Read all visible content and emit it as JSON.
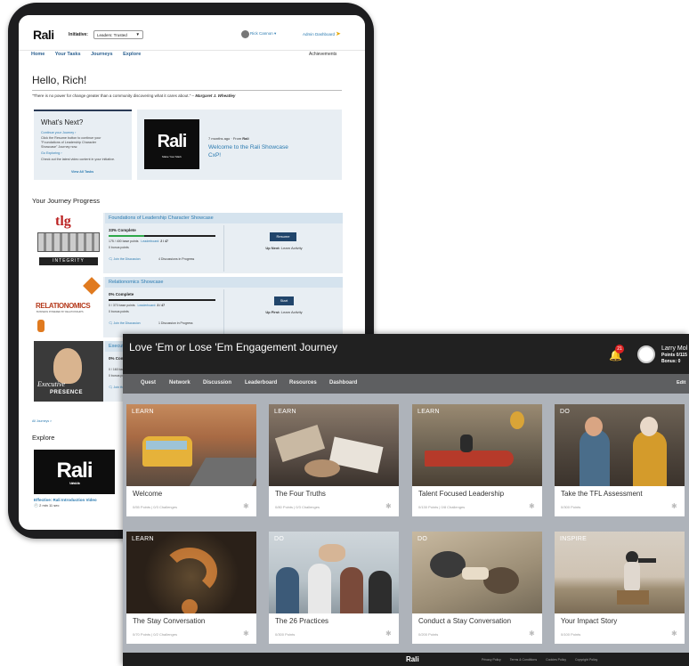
{
  "tablet": {
    "logo": "Rali",
    "initiative_label": "Initiative:",
    "initiative_value": "Leaders: Trusted",
    "user_name": "Rick Cannon",
    "admin_link": "Admin Dashboard",
    "nav": [
      "Home",
      "Your Tasks",
      "Journeys",
      "Explore"
    ],
    "achievements": "Achievements",
    "greeting": "Hello, Rich!",
    "quote_text": "\"There is no power for change greater than a community discovering what it cares about.\" –",
    "quote_author": "Margaret J. Wheatley",
    "whats_next": {
      "title": "What's Next?",
      "link1": "Continue your Journey",
      "text1": "Click the Resume button to continue your \"Foundations of Leadership Character Showcase\" Journey now.",
      "link2": "Go Exploring",
      "text2": "Check out the latest video content in your initiative.",
      "view_all": "View All Tasks"
    },
    "featured": {
      "video_logo": "Rali",
      "video_tagline": "Make Your Mark",
      "meta_time": "7 months ago",
      "meta_from": "From",
      "meta_source": "Rali",
      "title": "Welcome to the Rali Showcase CxP!"
    },
    "journey_progress_heading": "Your Journey Progress",
    "journeys": [
      {
        "title": "Foundations of Leadership Character Showcase",
        "percent_label": "33% Complete",
        "progress": 0.33,
        "points_line": "175 / 400 base points",
        "leaderboard_label": "Leaderboard:",
        "leaderboard_value": "2 / 47",
        "bonus": "0 bonus points",
        "discussion_link": "Join the Discussion",
        "discussion_count": "4 Discussions in Progress",
        "button": "Resume",
        "next_label": "Up Next:",
        "next_value": "Learn Activity",
        "img_text1": "tlg",
        "img_text2": "INTEGRITY"
      },
      {
        "title": "Relationomics Showcase",
        "percent_label": "0% Complete",
        "progress": 0,
        "points_line": "0 / 370 base points",
        "leaderboard_label": "Leaderboard:",
        "leaderboard_value": "3 / 47",
        "bonus": "0 bonus points",
        "discussion_link": "Join the Discussion",
        "discussion_count": "1 Discussion in Progress",
        "button": "Start",
        "next_label": "Up First:",
        "next_value": "Learn Activity",
        "img_text1": "RELATIONOMICS",
        "img_text2": "BUSINESS POWERED BY RELATIONSHIPS"
      },
      {
        "title": "Executi",
        "percent_label": "0% Com",
        "progress": 0,
        "points_line": "0 / 160 bas",
        "bonus": "0 bonus po",
        "discussion_link": "Join th",
        "img_text1": "Executive",
        "img_text2": "PRESENCE"
      }
    ],
    "all_journeys": "All Journeys >",
    "explore_heading": "Explore",
    "explore_video_logo": "Rali",
    "explore_video_tagline": "Make Your Mark",
    "explore_caption": "Effective: Rali Introduction Video",
    "explore_duration": "2 min 11 sec"
  },
  "window": {
    "title": "Love 'Em or Lose 'Em Engagement Journey",
    "notification_count": "21",
    "user_name": "Larry Mol",
    "points": "Points 0/115",
    "bonus": "Bonus: 0",
    "tabs": [
      "Quest",
      "Network",
      "Discussion",
      "Leaderboard",
      "Resources",
      "Dashboard"
    ],
    "edit": "Edit",
    "cards": [
      {
        "tag": "LEARN",
        "title": "Welcome",
        "meta": "0/55 Points | 0/3 Challenges"
      },
      {
        "tag": "LEARN",
        "title": "The Four Truths",
        "meta": "0/80 Points | 0/3 Challenges"
      },
      {
        "tag": "LEARN",
        "title": "Talent Focused Leadership",
        "meta": "0/130 Points | 0/8 Challenges"
      },
      {
        "tag": "DO",
        "title": "Take the TFL Assessment",
        "meta": "0/300 Points"
      },
      {
        "tag": "LEARN",
        "title": "The Stay Conversation",
        "meta": "0/70 Points | 0/2 Challenges"
      },
      {
        "tag": "DO",
        "title": "The 26 Practices",
        "meta": "0/300 Points"
      },
      {
        "tag": "DO",
        "title": "Conduct a Stay Conversation",
        "meta": "0/200 Points"
      },
      {
        "tag": "INSPIRE",
        "title": "Your Impact Story",
        "meta": "0/100 Points"
      }
    ],
    "footer_logo": "Rali",
    "footer_links": [
      "Privacy Policy",
      "Terms & Conditions",
      "Cookies Policy",
      "Copyright Policy"
    ]
  },
  "colors": {
    "accent_blue": "#2a7ab0",
    "button_navy": "#21456b",
    "progress_green": "#2ea84a",
    "header_dark": "#212121",
    "tab_gray": "#5e5f61"
  }
}
